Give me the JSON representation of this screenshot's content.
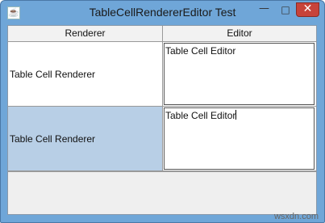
{
  "window": {
    "title": "TableCellRendererEditor Test",
    "minimize_glyph": "—",
    "maximize_glyph": "□",
    "close_glyph": "✕",
    "app_icon": "java-icon"
  },
  "table": {
    "headers": [
      "Renderer",
      "Editor"
    ],
    "rows": [
      {
        "renderer": "Table Cell Renderer",
        "editor": "Table Cell Editor",
        "selected": false
      },
      {
        "renderer": "Table Cell Renderer",
        "editor": "Table Cell Editor",
        "selected": true
      }
    ]
  },
  "watermark": "wsxdn.com",
  "colors": {
    "titlebar": "#6fa6d8",
    "selection": "#b8cfe6",
    "close_button": "#c7433a"
  }
}
